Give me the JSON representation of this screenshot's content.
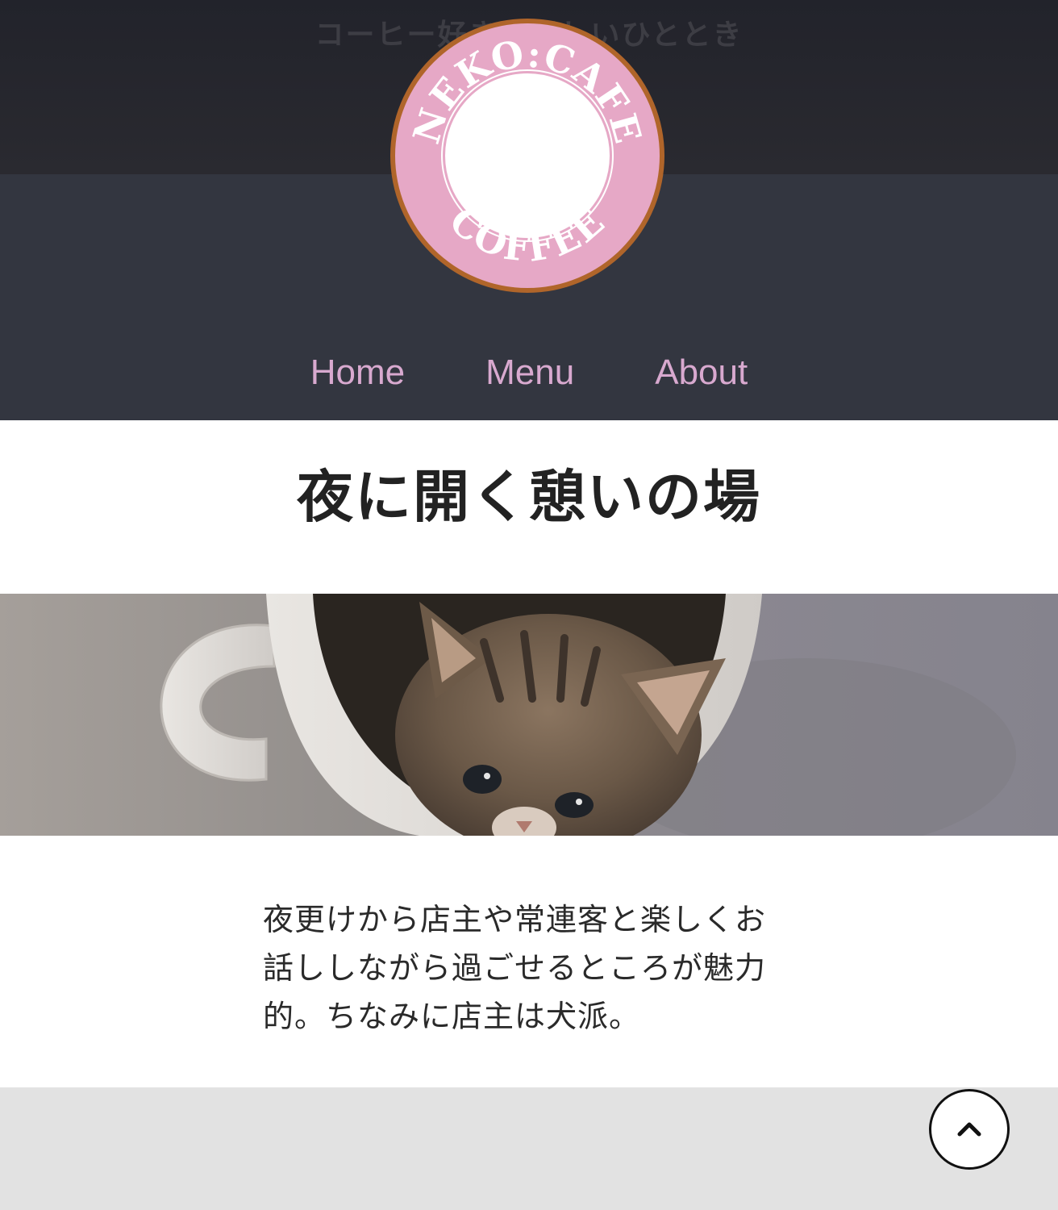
{
  "header": {
    "tagline": "コーヒー好きの楽しいひととき",
    "logo": {
      "top_text": "NEKO:CAFE",
      "bottom_text": "COFFEE"
    }
  },
  "nav": {
    "items": [
      {
        "label": "Home"
      },
      {
        "label": "Menu"
      },
      {
        "label": "About"
      }
    ]
  },
  "main": {
    "headline": "夜に開く憩いの場",
    "hero_image_icon": "kitten-in-coffee-cup-photo",
    "body_lines": [
      "夜更けから店主や常連客と楽しくお",
      "話ししながら過ごせるところが魅力",
      "的。ちなみに店主は犬派。"
    ]
  },
  "back_to_top_icon": "chevron-up-icon",
  "colors": {
    "header_dark": "#22232b",
    "header_mid": "#333640",
    "nav_link": "#d8a9cf",
    "logo_ring": "#e6a8c6",
    "logo_border": "#b0652a",
    "footer": "#e2e2e2"
  }
}
